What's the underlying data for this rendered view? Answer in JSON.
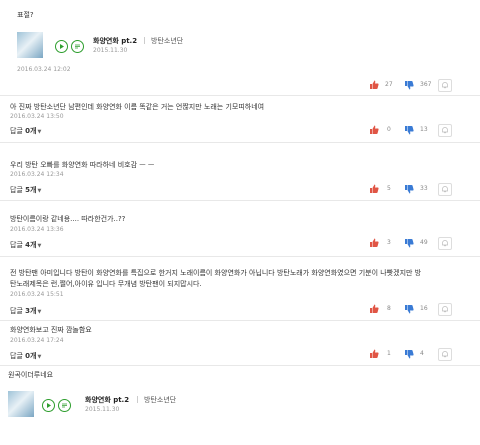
{
  "colors": {
    "like": "#e05545",
    "dislike": "#3a7bd5",
    "accent_green": "#2e9e2e"
  },
  "top_text": "표절?",
  "song1": {
    "title": "화양연화 pt.2",
    "artist": "방탄소년단",
    "date": "2015.11.30"
  },
  "post_date": "2016.03.24  12:02",
  "post_votes": {
    "like": "27",
    "dislike": "367"
  },
  "comments": [
    {
      "text": "아 진짜 방탄소년단 남편인데 화양연화 이름 똑같은 거는 언짢지만 노래는 기모띠하네여",
      "date": "2016.03.24  13:50",
      "reply_label": "답글",
      "reply_count": "0개",
      "like": "0",
      "dislike": "13"
    },
    {
      "text": "우리 방탄 오빠를 화양연화 따라하네 비호감 ㅡ ㅡ",
      "date": "2016.03.24  12:34",
      "reply_label": "답글",
      "reply_count": "5개",
      "like": "5",
      "dislike": "33"
    },
    {
      "text": "방탄이름이랑 같네용.... 따라한건가..??",
      "date": "2016.03.24  13:36",
      "reply_label": "답글",
      "reply_count": "4개",
      "like": "3",
      "dislike": "49"
    },
    {
      "text": "전 방탄팬 아미입니다 방탄이 화양연화를 특집으로 한거지 노래이름이 화양연화가 아닙니다 방탄노래가 화양연화였으면 기분이 나빳겠지만 방",
      "text2": "탄노래제목은 런,쩔어,아이유 입니다 무개념 방탄팬이 되지맙시다.",
      "date": "2016.03.24  15:51",
      "reply_label": "답글",
      "reply_count": "3개",
      "like": "8",
      "dislike": "16"
    },
    {
      "text": "화양연화보고 진짜 깜놀함요",
      "date": "2016.03.24  17:24",
      "reply_label": "답글",
      "reply_count": "0개",
      "like": "1",
      "dislike": "4"
    }
  ],
  "bottom_text": "원곡이더루네요",
  "song2": {
    "title": "화양연화 pt.2",
    "artist": "방탄소년단",
    "date": "2015.11.30"
  }
}
